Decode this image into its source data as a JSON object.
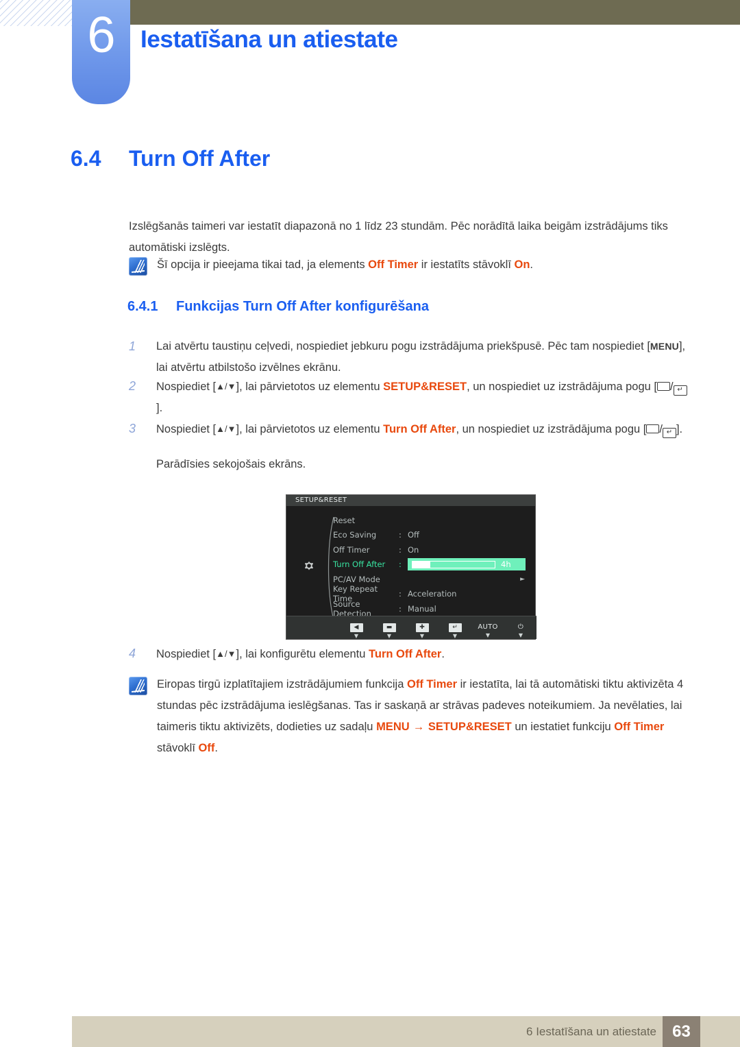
{
  "header": {
    "chapter_number": "6",
    "chapter_title": "Iestatīšana un atiestate"
  },
  "section": {
    "number": "6.4",
    "title": "Turn Off After"
  },
  "intro": {
    "text": "Izslēgšanās taimeri var iestatīt diapazonā no 1 līdz 23 stundām. Pēc norādītā laika beigām izstrādājums tiks automātiski izslēgts."
  },
  "note1": {
    "part1": "Šī opcija ir pieejama tikai tad, ja elements ",
    "hl1": "Off Timer",
    "part2": " ir iestatīts stāvoklī ",
    "hl2": "On",
    "part3": "."
  },
  "subsection": {
    "number": "6.4.1",
    "title": "Funkcijas Turn Off After konfigurēšana"
  },
  "steps": [
    {
      "num": "1",
      "part1": "Lai atvērtu taustiņu ceļvedi, nospiediet jebkuru pogu izstrādājuma priekšpusē. Pēc tam nospiediet [",
      "key": "MENU",
      "part2": "], lai atvērtu atbilstošo izvēlnes ekrānu."
    },
    {
      "num": "2",
      "part1": "Nospiediet [",
      "keys": "▲/▼",
      "part2": "], lai pārvietotos uz elementu ",
      "hl": "SETUP&RESET",
      "part3": ", un nospiediet uz izstrādājuma pogu [",
      "part4": "]."
    },
    {
      "num": "3",
      "part1": "Nospiediet [",
      "keys": "▲/▼",
      "part2": "], lai pārvietotos uz elementu ",
      "hl": "Turn Off After",
      "part3": ", un nospiediet uz izstrādājuma pogu [",
      "part4": "]."
    },
    {
      "num": "4",
      "part1": "Nospiediet [",
      "keys": "▲/▼",
      "part2": "], lai konfigurētu elementu ",
      "hl": "Turn Off After",
      "part3": "."
    }
  ],
  "substep_text": "Parādīsies sekojošais ekrāns.",
  "osd": {
    "title": "SETUP&RESET",
    "rows": [
      {
        "label": "Reset",
        "colon": "",
        "value": "",
        "selected": false,
        "type": "plain"
      },
      {
        "label": "Eco Saving",
        "colon": ":",
        "value": "Off",
        "selected": false,
        "type": "plain"
      },
      {
        "label": "Off Timer",
        "colon": ":",
        "value": "On",
        "selected": false,
        "type": "plain"
      },
      {
        "label": "Turn Off After",
        "colon": ":",
        "value": "4h",
        "selected": true,
        "type": "slider"
      },
      {
        "label": "PC/AV Mode",
        "colon": "",
        "value": "",
        "selected": false,
        "type": "submenu"
      },
      {
        "label": "Key Repeat Time",
        "colon": ":",
        "value": "Acceleration",
        "selected": false,
        "type": "plain"
      },
      {
        "label": "Source Detection",
        "colon": ":",
        "value": "Manual",
        "selected": false,
        "type": "plain"
      }
    ],
    "slider_value": "4h",
    "slider_percent": 22,
    "scroll_down_glyph": "▼",
    "submenu_glyph": "►",
    "footer_buttons": [
      {
        "name": "back-button",
        "glyph": "◀",
        "caret": "▼"
      },
      {
        "name": "minus-button",
        "glyph": "▬",
        "caret": "▼"
      },
      {
        "name": "plus-button",
        "glyph": "✚",
        "caret": "▼"
      },
      {
        "name": "enter-button",
        "glyph": "↵",
        "caret": "▼"
      },
      {
        "name": "auto-button",
        "glyph": "AUTO",
        "caret": "▼"
      },
      {
        "name": "power-button",
        "glyph": "⏻",
        "caret": "▼"
      }
    ]
  },
  "note2": {
    "part1": "Eiropas tirgū izplatītajiem izstrādājumiem funkcija ",
    "hl1": "Off Timer",
    "part2": " ir iestatīta, lai tā automātiski tiktu aktivizēta 4 stundas pēc izstrādājuma ieslēgšanas. Tas ir saskaņā ar strāvas padeves noteikumiem. Ja nevēlaties, lai taimeris tiktu aktivizēts, dodieties uz sadaļu ",
    "hl2": "MENU",
    "arrow": " → ",
    "hl3": "SETUP&RESET",
    "part3": " un iestatiet funkciju ",
    "hl4": "Off Timer",
    "part4": " stāvoklī ",
    "hl5": "Off",
    "part5": "."
  },
  "footer": {
    "label": "6 Iestatīšana un atiestate",
    "page": "63"
  },
  "colors": {
    "accent_blue": "#1a5ef0",
    "highlight_orange": "#e8490e",
    "olive": "#6e6b52",
    "footer_bg": "#d6d0bd",
    "page_box": "#8b8174",
    "osd_select_green": "#38e2a0"
  }
}
